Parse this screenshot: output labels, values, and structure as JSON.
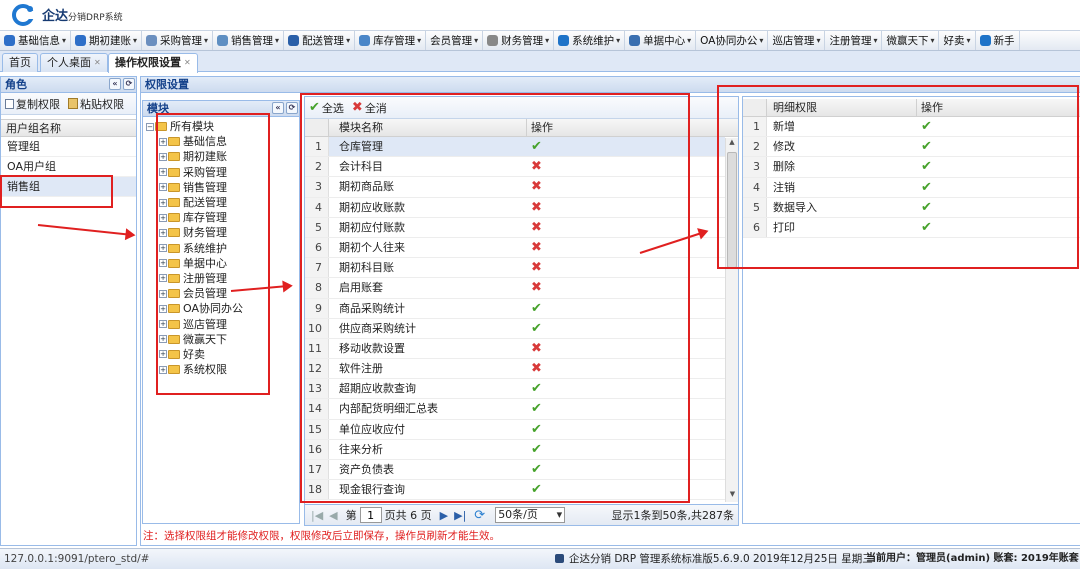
{
  "app": {
    "title": "企达",
    "subtitle": "分销DRP系统"
  },
  "menu": [
    {
      "label": "基础信息",
      "icon": "info-icon",
      "color": "#2e6fc8"
    },
    {
      "label": "期初建账",
      "icon": "account-icon",
      "color": "#2e6fc8"
    },
    {
      "label": "采购管理",
      "icon": "purchase-icon",
      "color": "#6b8fbf"
    },
    {
      "label": "销售管理",
      "icon": "sales-icon",
      "color": "#5f8fc2"
    },
    {
      "label": "配送管理",
      "icon": "delivery-icon",
      "color": "#2a5fa8"
    },
    {
      "label": "库存管理",
      "icon": "inventory-icon",
      "color": "#4a86c8"
    },
    {
      "label": "会员管理",
      "icon": "",
      "color": ""
    },
    {
      "label": "财务管理",
      "icon": "finance-icon",
      "color": "#888888"
    },
    {
      "label": "系统维护",
      "icon": "maintenance-icon",
      "color": "#1e73c8"
    },
    {
      "label": "单据中心",
      "icon": "document-icon",
      "color": "#3a6fb0"
    },
    {
      "label": "OA协同办公",
      "icon": "",
      "color": ""
    },
    {
      "label": "巡店管理",
      "icon": "",
      "color": ""
    },
    {
      "label": "注册管理",
      "icon": "",
      "color": ""
    },
    {
      "label": "微赢天下",
      "icon": "",
      "color": ""
    },
    {
      "label": "好卖",
      "icon": "",
      "color": ""
    },
    {
      "label": "新手",
      "icon": "help-icon",
      "color": "#1e73c8"
    }
  ],
  "tabs": [
    {
      "label": "首页",
      "closable": false,
      "active": false
    },
    {
      "label": "个人桌面",
      "closable": true,
      "active": false
    },
    {
      "label": "操作权限设置",
      "closable": true,
      "active": true
    }
  ],
  "role_panel": {
    "title": "角色",
    "copy_label": "复制权限",
    "paste_label": "粘贴权限",
    "column": "用户组名称",
    "groups": [
      "管理组",
      "OA用户组",
      "销售组"
    ]
  },
  "perm_panel": {
    "title": "权限设置"
  },
  "module_panel": {
    "title": "模块",
    "root": "所有模块",
    "items": [
      "基础信息",
      "期初建账",
      "采购管理",
      "销售管理",
      "配送管理",
      "库存管理",
      "财务管理",
      "系统维护",
      "单据中心",
      "注册管理",
      "会员管理",
      "OA协同办公",
      "巡店管理",
      "微赢天下",
      "好卖",
      "系统权限"
    ]
  },
  "module_grid": {
    "select_all": "全选",
    "cancel_all": "全消",
    "col_name": "模块名称",
    "col_op": "操作",
    "rows": [
      {
        "n": "1",
        "name": "仓库管理",
        "ok": true
      },
      {
        "n": "2",
        "name": "会计科目",
        "ok": false
      },
      {
        "n": "3",
        "name": "期初商品账",
        "ok": false
      },
      {
        "n": "4",
        "name": "期初应收账款",
        "ok": false
      },
      {
        "n": "5",
        "name": "期初应付账款",
        "ok": false
      },
      {
        "n": "6",
        "name": "期初个人往来",
        "ok": false
      },
      {
        "n": "7",
        "name": "期初科目账",
        "ok": false
      },
      {
        "n": "8",
        "name": "启用账套",
        "ok": false
      },
      {
        "n": "9",
        "name": "商品采购统计",
        "ok": true
      },
      {
        "n": "10",
        "name": "供应商采购统计",
        "ok": true
      },
      {
        "n": "11",
        "name": "移动收款设置",
        "ok": false
      },
      {
        "n": "12",
        "name": "软件注册",
        "ok": false
      },
      {
        "n": "13",
        "name": "超期应收款查询",
        "ok": true
      },
      {
        "n": "14",
        "name": "内部配货明细汇总表",
        "ok": true
      },
      {
        "n": "15",
        "name": "单位应收应付",
        "ok": true
      },
      {
        "n": "16",
        "name": "往来分析",
        "ok": true
      },
      {
        "n": "17",
        "name": "资产负债表",
        "ok": true
      },
      {
        "n": "18",
        "name": "现金银行查询",
        "ok": true
      }
    ],
    "pager": {
      "page_prefix": "第",
      "page_value": "1",
      "page_suffix": "页共 6 页",
      "page_size": "50条/页",
      "summary": "显示1条到50条,共287条"
    }
  },
  "detail_grid": {
    "col_name": "明细权限",
    "col_op": "操作",
    "rows": [
      {
        "n": "1",
        "name": "新增"
      },
      {
        "n": "2",
        "name": "修改"
      },
      {
        "n": "3",
        "name": "删除"
      },
      {
        "n": "4",
        "name": "注销"
      },
      {
        "n": "5",
        "name": "数据导入"
      },
      {
        "n": "6",
        "name": "打印"
      }
    ]
  },
  "note": "注：选择权限组才能修改权限，权限修改后立即保存，操作员刷新才能生效。",
  "status": {
    "url": "127.0.0.1:9091/ptero_std/#",
    "info": "企达分销 DRP 管理系统标准版5.6.9.0 2019年12月25日 星期三",
    "user": "当前用户：管理员(admin) 账套: 2019年账套"
  },
  "glyphs": {
    "check": "✔",
    "cross": "✖",
    "close": "✕",
    "caret": "▾"
  },
  "colors": {
    "accent": "#15428b",
    "annotation": "#e02020",
    "check": "#46a22b",
    "cross": "#d83a3a"
  }
}
